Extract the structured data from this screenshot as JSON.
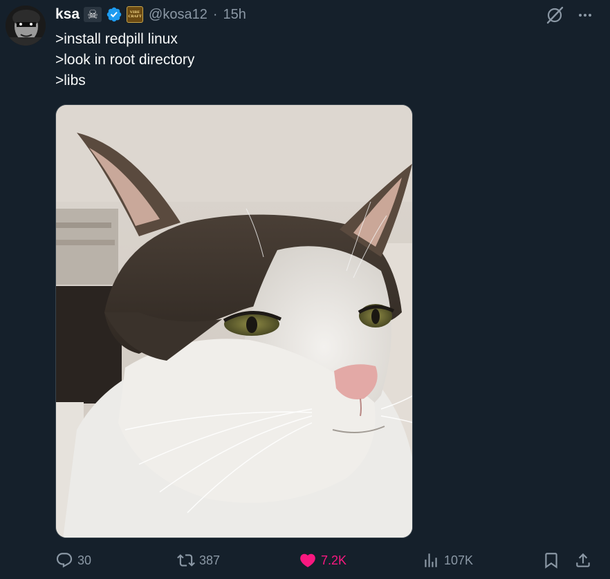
{
  "author": {
    "display_name": "ksa",
    "handle": "@kosa12",
    "separator": "·",
    "time": "15h",
    "badges": [
      "skull-crossbones-icon",
      "verified-check-icon",
      "vibe-craft-badge-icon"
    ],
    "badge_vibe_text_1": "VIBE",
    "badge_vibe_text_2": "CRAFT"
  },
  "tweet": {
    "lines": [
      ">install redpill linux",
      ">look in root directory",
      ">libs"
    ]
  },
  "media": {
    "subject_icon": "cat-photo"
  },
  "actions": {
    "replies": "30",
    "reposts": "387",
    "likes": "7.2K",
    "views": "107K",
    "liked": true
  },
  "colors": {
    "background": "#15202b",
    "text_primary": "#f7f9f9",
    "text_secondary": "#8b98a5",
    "like_active": "#f91880",
    "verified_blue": "#1d9bf0"
  },
  "icons": {
    "top_right": [
      "grok-icon",
      "more-options-icon"
    ],
    "action_bar": [
      "reply-icon",
      "repost-icon",
      "like-icon",
      "views-icon",
      "bookmark-icon",
      "share-icon"
    ]
  }
}
